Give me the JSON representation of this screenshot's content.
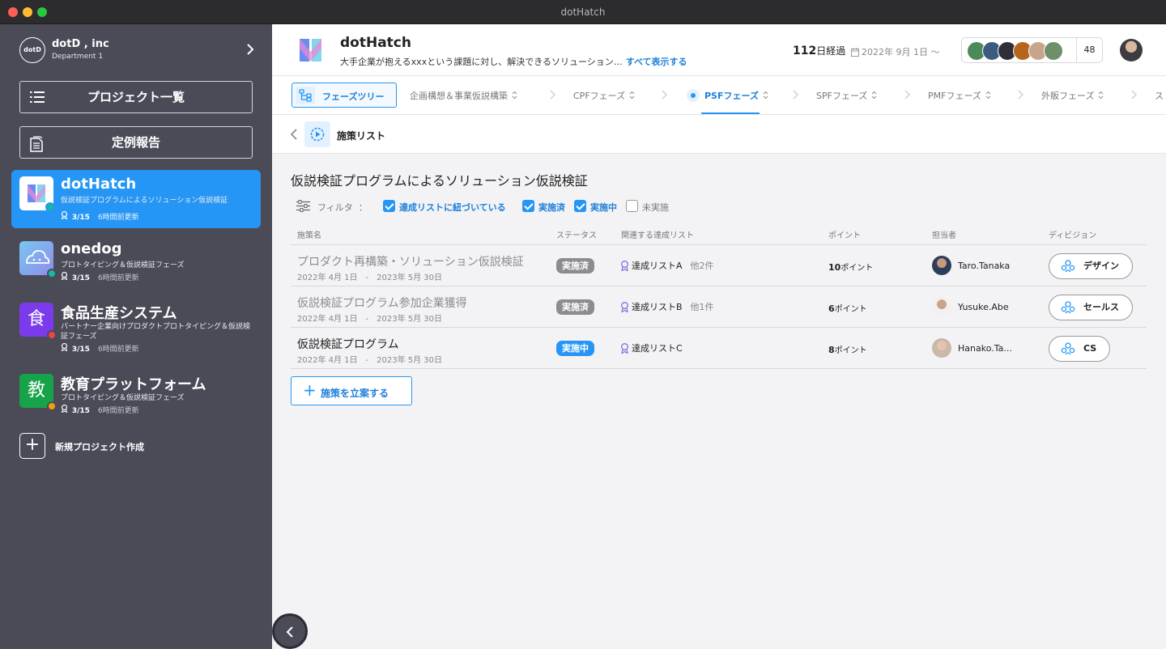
{
  "window": {
    "title": "dotHatch"
  },
  "org": {
    "logo": "dotD",
    "name": "dotD , inc",
    "dept": "Department 1"
  },
  "nav": {
    "projects": "プロジェクト一覧",
    "report": "定例報告"
  },
  "projects": [
    {
      "name": "dotHatch",
      "desc": "仮説検証プログラムによるソリューション仮説検証",
      "count": "3/15",
      "updated": "6時間前更新",
      "dot": "#14b8a6"
    },
    {
      "name": "onedog",
      "desc": "プロトタイピング＆仮説検証フェーズ",
      "count": "3/15",
      "updated": "6時間前更新",
      "dot": "#14b8a6"
    },
    {
      "name": "食品生産システム",
      "icon": "食",
      "desc": "パートナー企業向けプロダクトプロトタイピング＆仮説検証フェーズ",
      "count": "3/15",
      "updated": "6時間前更新",
      "dot": "#ef4444"
    },
    {
      "name": "教育プラットフォーム",
      "icon": "教",
      "desc": "プロトタイピング＆仮説検証フェーズ",
      "count": "3/15",
      "updated": "6時間前更新",
      "dot": "#f59e0b"
    }
  ],
  "new_project": "新規プロジェクト作成",
  "header": {
    "title": "dotHatch",
    "desc": "大手企業が抱えるxxxという課題に対し、解決できるソリューション…",
    "show_all": "すべて表示する",
    "days_num": "112",
    "days_unit": "日経過",
    "date": "2022年 9月 1日 ～",
    "member_count": "48"
  },
  "phase_tree": "フェーズツリー",
  "tabs": [
    "企画構想＆事業仮説構築",
    "CPFフェーズ",
    "PSFフェーズ",
    "SPFフェーズ",
    "PMFフェーズ",
    "外販フェーズ",
    "ス"
  ],
  "subbar": {
    "title": "施策リスト"
  },
  "content": {
    "title": "仮説検証プログラムによるソリューション仮説検証",
    "filter_label": "フィルタ",
    "filter_colon": "：",
    "filters": [
      {
        "label": "達成リストに紐づいている",
        "checked": true
      },
      {
        "label": "実施済",
        "checked": true
      },
      {
        "label": "実施中",
        "checked": true
      },
      {
        "label": "未実施",
        "checked": false
      }
    ]
  },
  "table": {
    "headers": [
      "施策名",
      "ステータス",
      "関連する達成リスト",
      "ポイント",
      "担当者",
      "ディビジョン"
    ],
    "rows": [
      {
        "name": "プロダクト再構築・ソリューション仮説検証",
        "dates": "2022年 4月 1日　-　2023年 5月 30日",
        "status": "実施済",
        "list": "達成リストA",
        "others": "他2件",
        "points": "10",
        "points_unit": "ポイント",
        "user": "Taro.Tanaka",
        "division": "デザイン"
      },
      {
        "name": "仮説検証プログラム参加企業獲得",
        "dates": "2022年 4月 1日　-　2023年 5月 30日",
        "status": "実施済",
        "list": "達成リストB",
        "others": "他1件",
        "points": "6",
        "points_unit": "ポイント",
        "user": "Yusuke.Abe",
        "division": "セールス"
      },
      {
        "name": "仮説検証プログラム",
        "dates": "2022年 4月 1日　-　2023年 5月 30日",
        "status": "実施中",
        "list": "達成リストC",
        "others": "",
        "points": "8",
        "points_unit": "ポイント",
        "user": "Hanako.Ta...",
        "division": "CS"
      }
    ]
  },
  "add_button": "施策を立案する",
  "colors": {
    "accent": "#2596f5",
    "sidebar": "#4a4b57",
    "done": "#8c8c90"
  }
}
